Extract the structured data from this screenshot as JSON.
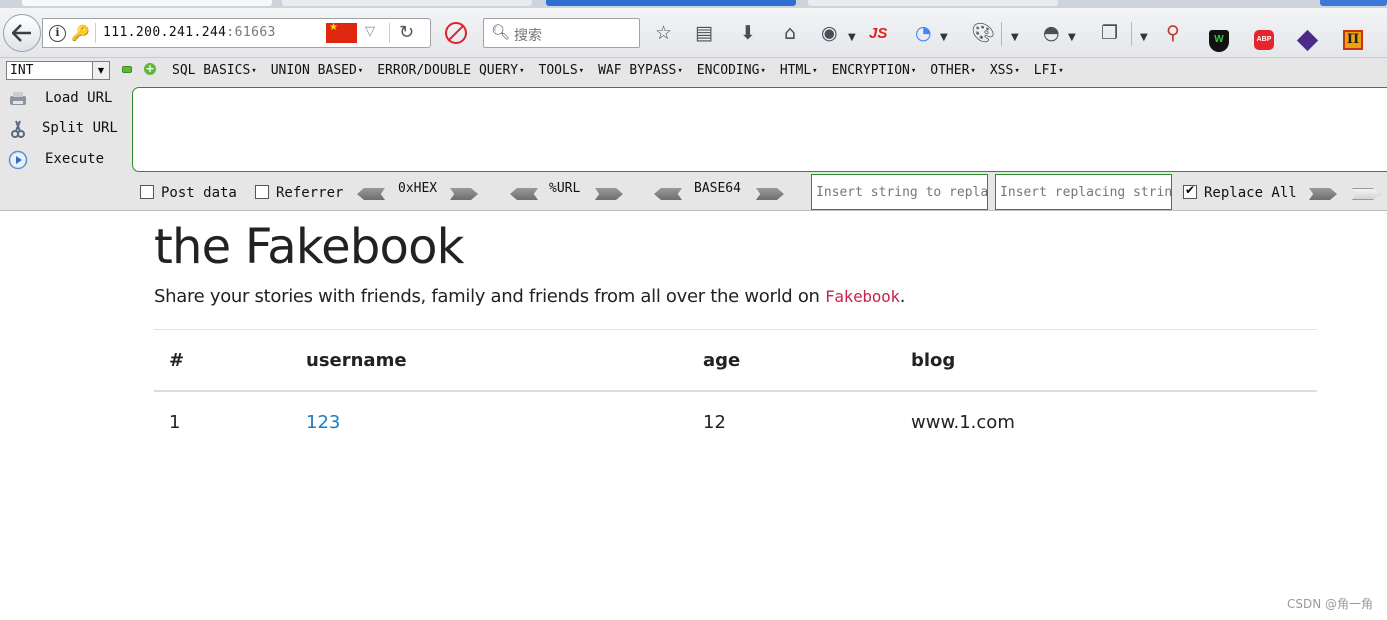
{
  "browser": {
    "url_host": "111.200.241.244",
    "url_port": ":61663",
    "search_placeholder": "搜索",
    "js_badge": "JS",
    "abp_badge": "ABP",
    "noscript_shield": "W",
    "pi_badge": "П"
  },
  "hackbar": {
    "type_select": "INT",
    "menus": [
      "SQL BASICS",
      "UNION BASED",
      "ERROR/DOUBLE QUERY",
      "TOOLS",
      "WAF BYPASS",
      "ENCODING",
      "HTML",
      "ENCRYPTION",
      "OTHER",
      "XSS",
      "LFI"
    ],
    "actions": {
      "load_url": "Load URL",
      "split_url": "Split URL",
      "execute": "Execute"
    },
    "url_value": "",
    "options": {
      "post_data": "Post data",
      "referrer": "Referrer",
      "hex": "0xHEX",
      "url": "%URL",
      "base64": "BASE64",
      "replace_placeholder": "Insert string to replace",
      "replacing_placeholder": "Insert replacing string",
      "replace_all": "Replace All"
    }
  },
  "page": {
    "title": "the Fakebook",
    "lead_text": "Share your stories with friends, family and friends from all over the world on ",
    "lead_brand": "Fakebook",
    "lead_end": ".",
    "table": {
      "headers": [
        "#",
        "username",
        "age",
        "blog"
      ],
      "rows": [
        {
          "id": "1",
          "username": "123",
          "age": "12",
          "blog": "www.1.com"
        }
      ]
    }
  },
  "watermark": "CSDN @角一角"
}
